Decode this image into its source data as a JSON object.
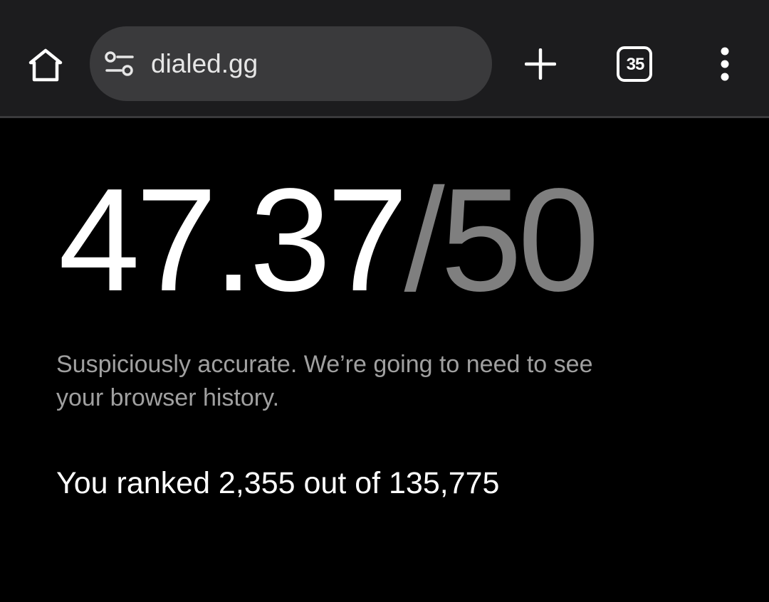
{
  "browser": {
    "url": "dialed.gg",
    "tab_count": "35",
    "icons": {
      "home": "home-icon",
      "site_settings": "tune-icon",
      "new_tab": "plus-icon",
      "tab_switcher": "tab-switcher-icon",
      "menu": "more-vert-icon"
    }
  },
  "result": {
    "score": "47.37",
    "score_max": "/50",
    "message": "Suspiciously accurate. We’re going to need to see your browser history.",
    "rank_text": "You ranked 2,355 out of 135,775"
  },
  "colors": {
    "toolbar_bg": "#1c1c1e",
    "omnibox_bg": "#3a3a3c",
    "page_bg": "#000000",
    "score_primary": "#ffffff",
    "score_secondary": "#7f7f7f",
    "message_text": "#a0a0a0"
  }
}
